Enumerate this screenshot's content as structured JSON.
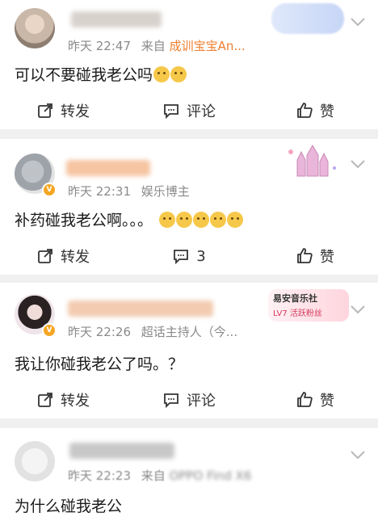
{
  "comments": [
    {
      "meta": "昨天 22:47",
      "source_prefix": "来自",
      "source": "成训宝宝An...",
      "content": "可以不要碰我老公吗",
      "actions": {
        "repost": "转发",
        "comment": "评论",
        "like": "赞"
      }
    },
    {
      "meta": "昨天 22:31",
      "source_prefix": "",
      "source": "娱乐博主",
      "content": "补药碰我老公啊。。。",
      "actions": {
        "repost": "转发",
        "comment": "3",
        "like": "赞"
      }
    },
    {
      "meta": "昨天 22:26",
      "source_prefix": "",
      "source": "超话主持人（今...",
      "content": "我让你碰我老公了吗。？",
      "fan_badge": {
        "title": "易安音乐社",
        "level": "LV7 活跃粉丝"
      },
      "actions": {
        "repost": "转发",
        "comment": "评论",
        "like": "赞"
      }
    },
    {
      "meta": "昨天 22:23",
      "source_prefix": "来自",
      "source": "OPPO Find X6",
      "content": "为什么碰我老公"
    }
  ],
  "colors": {
    "source_orange": "#ef7f2e",
    "separator": "#f0f0f0",
    "meta_gray": "#8a8a8a"
  },
  "icons": [
    "repost-icon",
    "comment-icon",
    "like-icon",
    "chevron-down-icon",
    "verified-badge-icon"
  ]
}
